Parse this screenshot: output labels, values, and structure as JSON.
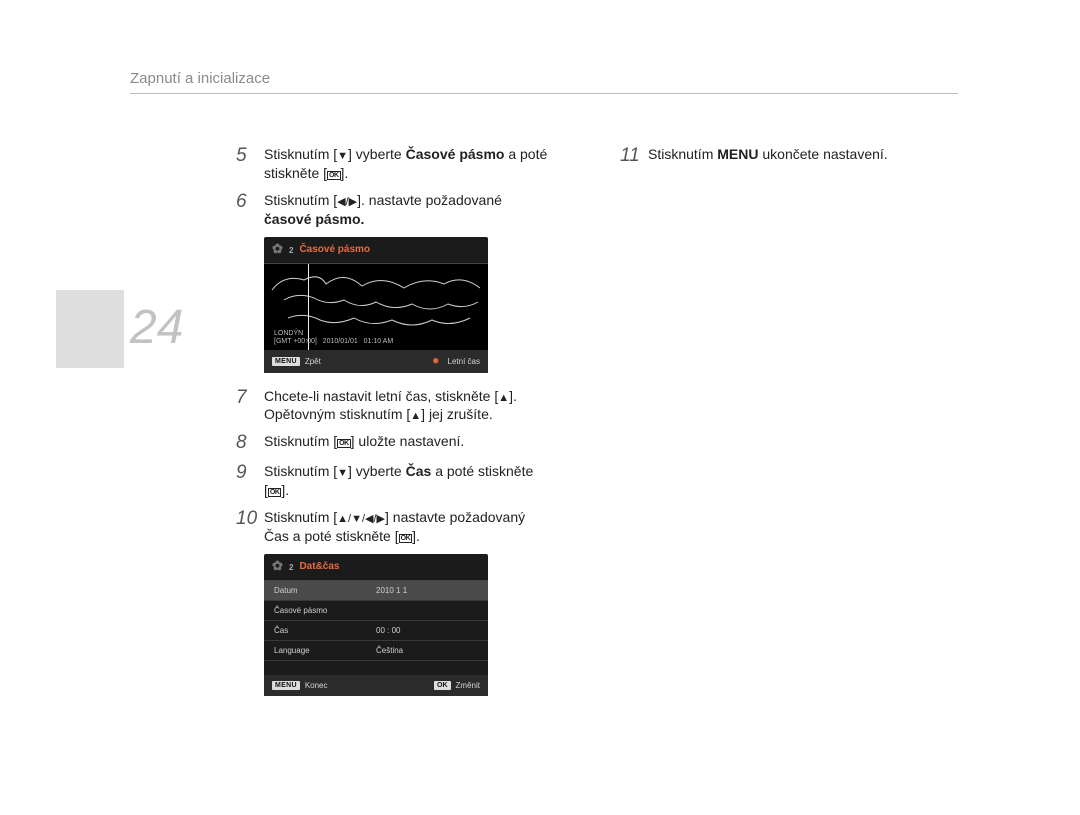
{
  "header": "Zapnutí a inicializace",
  "page_number": "24",
  "steps": {
    "5": {
      "pre": "Stisknutím [",
      "icon": "▼",
      "mid": "] vyberte ",
      "bold": "Časové pásmo",
      "post": " a poté stiskněte [",
      "end": "]."
    },
    "6": {
      "pre": "Stisknutím [",
      "icon": "◀/▶",
      "mid": "]. nastavte požadované",
      "bold": "časové pásmo."
    },
    "7": {
      "line1_pre": "Chcete-li nastavit letní čas, stiskněte [",
      "icon1": "▲",
      "line1_post": "].",
      "line2_pre": "Opětovným stisknutím [",
      "icon2": "▲",
      "line2_post": "] jej zrušíte."
    },
    "8": {
      "pre": "Stisknutím [",
      "post": "] uložte nastavení."
    },
    "9": {
      "pre": "Stisknutím [",
      "icon": "▼",
      "mid": "] vyberte ",
      "bold": "Čas",
      "post1": " a poté stiskněte",
      "post2": "[",
      "post3": "]."
    },
    "10": {
      "pre": "Stisknutím [",
      "icon": "▲/▼/◀/▶",
      "mid": "] nastavte požadovaný",
      "post1": "Čas a poté stiskněte [",
      "post2": "]."
    },
    "11": {
      "pre": "Stisknutím ",
      "bold": "MENU",
      "post": " ukončete nastavení."
    }
  },
  "screen1": {
    "title": "Časové pásmo",
    "gear_sub": "2",
    "city": "LONDÝN",
    "gmt": "[GMT +00:00]",
    "date": "2010/01/01",
    "time": "01:10 AM",
    "menu_chip": "MENU",
    "back": "Zpět",
    "dst": "Letní čas"
  },
  "screen2": {
    "title": "Dat&čas",
    "gear_sub": "2",
    "rows": {
      "r0": {
        "label": "Datum",
        "value": "2010 1 1"
      },
      "r1": {
        "label": "Časové pásmo",
        "value": ""
      },
      "r2": {
        "label": "Čas",
        "value": "00 : 00"
      },
      "r3": {
        "label": "Language",
        "value": "Čeština"
      }
    },
    "menu_chip": "MENU",
    "end": "Konec",
    "ok_chip": "OK",
    "change": "Změnit"
  },
  "ok_label": "OK"
}
